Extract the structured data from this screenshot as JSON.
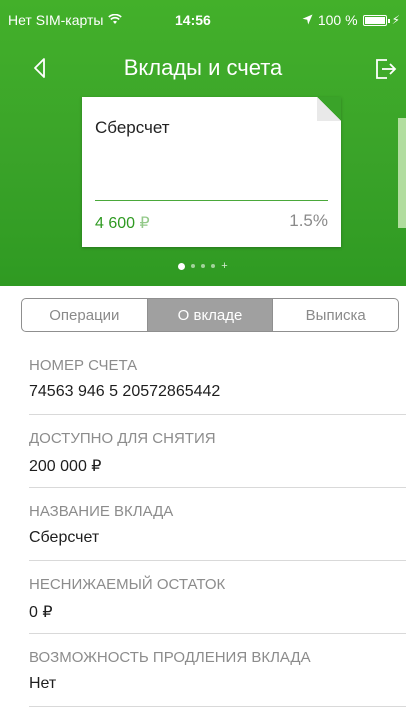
{
  "status_bar": {
    "carrier": "Нет SIM-карты",
    "time": "14:56",
    "battery_percent": "100 %"
  },
  "nav": {
    "title": "Вклады и счета",
    "back_icon": "back-chevron-icon",
    "exit_icon": "logout-icon"
  },
  "card": {
    "name": "Сберсчет",
    "amount": "4 600",
    "currency": "₽",
    "rate": "1.5%"
  },
  "pager": {
    "total": 4,
    "active_index": 0
  },
  "tabs": [
    {
      "label": "Операции",
      "active": false
    },
    {
      "label": "О вкладе",
      "active": true
    },
    {
      "label": "Выписка",
      "active": false
    }
  ],
  "details": [
    {
      "label": "НОМЕР СЧЕТА",
      "value": "74563 946 5 20572865442"
    },
    {
      "label": "ДОСТУПНО ДЛЯ СНЯТИЯ",
      "value": "200 000 ₽"
    },
    {
      "label": "НАЗВАНИЕ ВКЛАДА",
      "value": "Сберсчет"
    },
    {
      "label": "НЕСНИЖАЕМЫЙ ОСТАТОК",
      "value": "0 ₽"
    },
    {
      "label": "ВОЗМОЖНОСТЬ ПРОДЛЕНИЯ ВКЛАДА",
      "value": "Нет"
    }
  ],
  "colors": {
    "brand_green": "#3aa329",
    "amount_green": "#2f9a22",
    "active_tab": "#a0a0a0"
  }
}
